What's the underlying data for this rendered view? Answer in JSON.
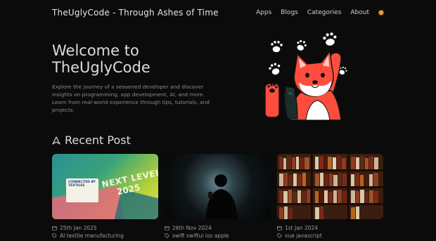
{
  "header": {
    "site_title": "TheUglyCode - Through Ashes of Time",
    "nav": [
      {
        "label": "Apps"
      },
      {
        "label": "Blogs"
      },
      {
        "label": "Categories"
      },
      {
        "label": "About"
      }
    ],
    "theme_icon": "sun-icon"
  },
  "hero": {
    "title_line1": "Welcome to",
    "title_line2": "TheUglyCode",
    "description": "Explore the journey of a seasoned developer and discover insights on programming, app development, AI, and more. Learn from real-world experience through tips, tutorials, and projects.",
    "art_icon": "shiba-paws-illustration"
  },
  "recent": {
    "heading": "Recent Post",
    "posts": [
      {
        "date": "25th Jan 2025",
        "tags": "AI textile manufacturing",
        "image_text_1": "NEXT LEVEL",
        "image_text_2": "2025",
        "image_text_3": "CONNECTED BY TEXTILES"
      },
      {
        "date": "26th Nov 2024",
        "tags": "swift swiftui ios apple"
      },
      {
        "date": "1st Jan 2024",
        "tags": "vue javascript"
      }
    ]
  },
  "colors": {
    "background": "#0b0b0b",
    "accent": "#ff4d3d"
  }
}
